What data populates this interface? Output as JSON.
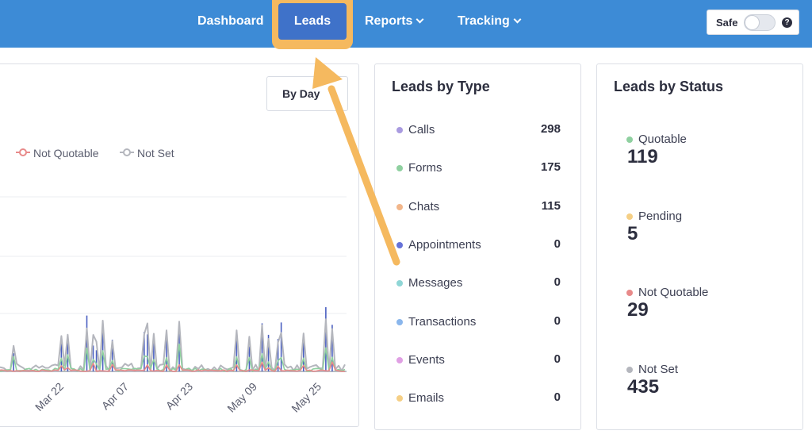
{
  "nav": {
    "dashboard": "Dashboard",
    "leads": "Leads",
    "reports": "Reports",
    "tracking": "Tracking",
    "safe_label": "Safe",
    "help": "?"
  },
  "chart": {
    "range_button": "By Day",
    "legend": [
      {
        "name": "Not Quotable",
        "color": "#e88a8a"
      },
      {
        "name": "Not Set",
        "color": "#b4b6bd"
      }
    ],
    "x_ticks": [
      "Mar 22",
      "Apr 07",
      "Apr 23",
      "May 09",
      "May 25"
    ]
  },
  "leads_by_type": {
    "title": "Leads by Type",
    "items": [
      {
        "label": "Calls",
        "value": "298",
        "color": "#a99be0"
      },
      {
        "label": "Forms",
        "value": "175",
        "color": "#8fd0a0"
      },
      {
        "label": "Chats",
        "value": "115",
        "color": "#f2b68a"
      },
      {
        "label": "Appointments",
        "value": "0",
        "color": "#6672d8"
      },
      {
        "label": "Messages",
        "value": "0",
        "color": "#8fd6d6"
      },
      {
        "label": "Transactions",
        "value": "0",
        "color": "#8ab6ec"
      },
      {
        "label": "Events",
        "value": "0",
        "color": "#e0a0e4"
      },
      {
        "label": "Emails",
        "value": "0",
        "color": "#f5cf85"
      }
    ]
  },
  "leads_by_status": {
    "title": "Leads by Status",
    "items": [
      {
        "label": "Quotable",
        "value": "119",
        "color": "#8fd0a0"
      },
      {
        "label": "Pending",
        "value": "5",
        "color": "#f5cf85"
      },
      {
        "label": "Not Quotable",
        "value": "29",
        "color": "#e88a8a"
      },
      {
        "label": "Not Set",
        "value": "435",
        "color": "#b4b6bd"
      }
    ]
  },
  "colors": {
    "header": "#3d8bd6",
    "leads_active": "#3f72c9",
    "highlight": "#f5b95f"
  }
}
